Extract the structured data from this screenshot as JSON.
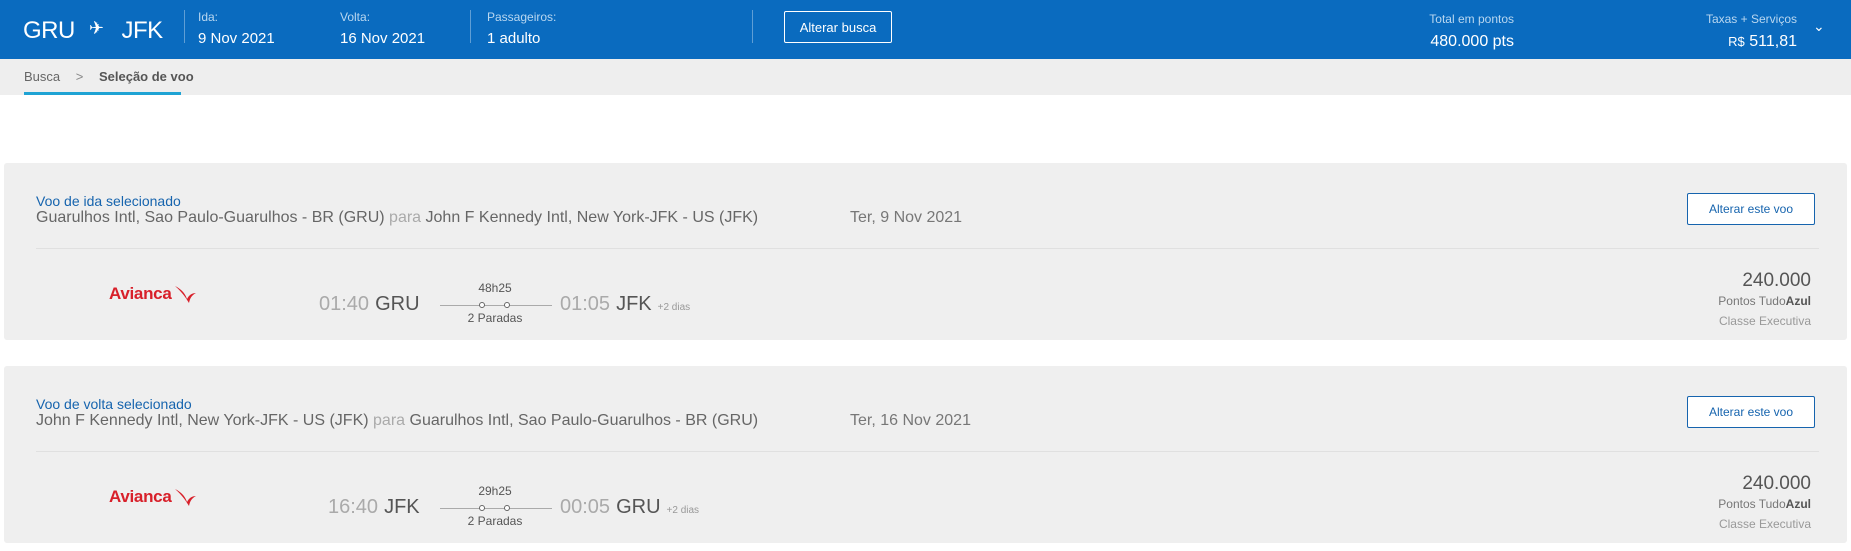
{
  "header": {
    "origin": "GRU",
    "destination": "JFK",
    "ida_label": "Ida:",
    "ida_value": "9 Nov 2021",
    "volta_label": "Volta:",
    "volta_value": "16 Nov 2021",
    "passengers_label": "Passageiros:",
    "passengers_value": "1 adulto",
    "change_search_label": "Alterar busca",
    "total_points_label": "Total em pontos",
    "total_points_value": "480.000 pts",
    "taxes_label": "Taxas + Serviços",
    "taxes_currency": "R$",
    "taxes_value": "511,81",
    "brand_color": "#0a6bbf"
  },
  "breadcrumb": {
    "items": [
      "Busca",
      "Seleção de voo"
    ],
    "separator": ">"
  },
  "flights": [
    {
      "selected_label": "Voo de ida selecionado",
      "from": "Guarulhos Intl, Sao Paulo-Guarulhos - BR (GRU)",
      "para": "para",
      "to": "John F Kennedy Intl, New York-JFK - US (JFK)",
      "date": "Ter, 9 Nov 2021",
      "change_label": "Alterar este voo",
      "airline": "Avianca",
      "dep_time": "01:40",
      "dep_code": "GRU",
      "duration": "48h25",
      "stops": "2 Paradas",
      "arr_time": "01:05",
      "arr_code": "JFK",
      "plus_days": "+2 dias",
      "points": "240.000",
      "program_prefix": "Pontos Tudo",
      "program_bold": "Azul",
      "cabin": "Classe Executiva"
    },
    {
      "selected_label": "Voo de volta selecionado",
      "from": "John F Kennedy Intl, New York-JFK - US (JFK)",
      "para": "para",
      "to": "Guarulhos Intl, Sao Paulo-Guarulhos - BR (GRU)",
      "date": "Ter, 16 Nov 2021",
      "change_label": "Alterar este voo",
      "airline": "Avianca",
      "dep_time": "16:40",
      "dep_code": "JFK",
      "duration": "29h25",
      "stops": "2 Paradas",
      "arr_time": "00:05",
      "arr_code": "GRU",
      "plus_days": "+2 dias",
      "points": "240.000",
      "program_prefix": "Pontos Tudo",
      "program_bold": "Azul",
      "cabin": "Classe Executiva"
    }
  ],
  "icons": {
    "plane": "airplane-icon",
    "chevron": "chevron-down-icon",
    "airline_logo": "avianca-bird-logo"
  }
}
